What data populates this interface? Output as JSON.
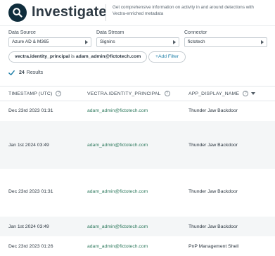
{
  "header": {
    "title": "Investigate",
    "subtitle": "Get comprehensive information on activity in and around detections with Vectra-enriched metadata"
  },
  "filters": {
    "data_source": {
      "label": "Data Source",
      "value": "Azure AD & M365"
    },
    "data_stream": {
      "label": "Data Stream",
      "value": "Signins"
    },
    "connector": {
      "label": "Connector",
      "value": "fictotech"
    }
  },
  "query": {
    "field": "vectra.identity_principal",
    "operator": " is ",
    "value": "adam_admin@fictotech.com",
    "add_filter_label": "+Add Filter"
  },
  "results": {
    "count": "24",
    "label": "Results"
  },
  "table": {
    "columns": [
      "TIMESTAMP (UTC)",
      "VECTRA.IDENTITY_PRINCIPAL",
      "APP_DISPLAY_NAME"
    ],
    "rows": [
      [
        "Dec 23rd 2023 01:31",
        "adam_admin@fictotech.com",
        "Thunder Jaw Backdoor"
      ],
      [
        "Jan 1st 2024 03:49",
        "adam_admin@fictotech.com",
        "Thunder Jaw Backdoor"
      ],
      [
        "Dec 23rd 2023 01:31",
        "adam_admin@fictotech.com",
        "Thunder Jaw Backdoor"
      ],
      [
        "Jan 1st 2024 03:49",
        "adam_admin@fictotech.com",
        "Thunder Jaw Backdoor"
      ],
      [
        "Dec 23rd 2023 01:26",
        "adam_admin@fictotech.com",
        "PnP Management Shell"
      ]
    ]
  },
  "colors": {
    "logo_bg": "#0f2d3c",
    "link": "#1f7fa8",
    "principal_text": "#2f7a5e",
    "check": "#1f7fa8"
  }
}
